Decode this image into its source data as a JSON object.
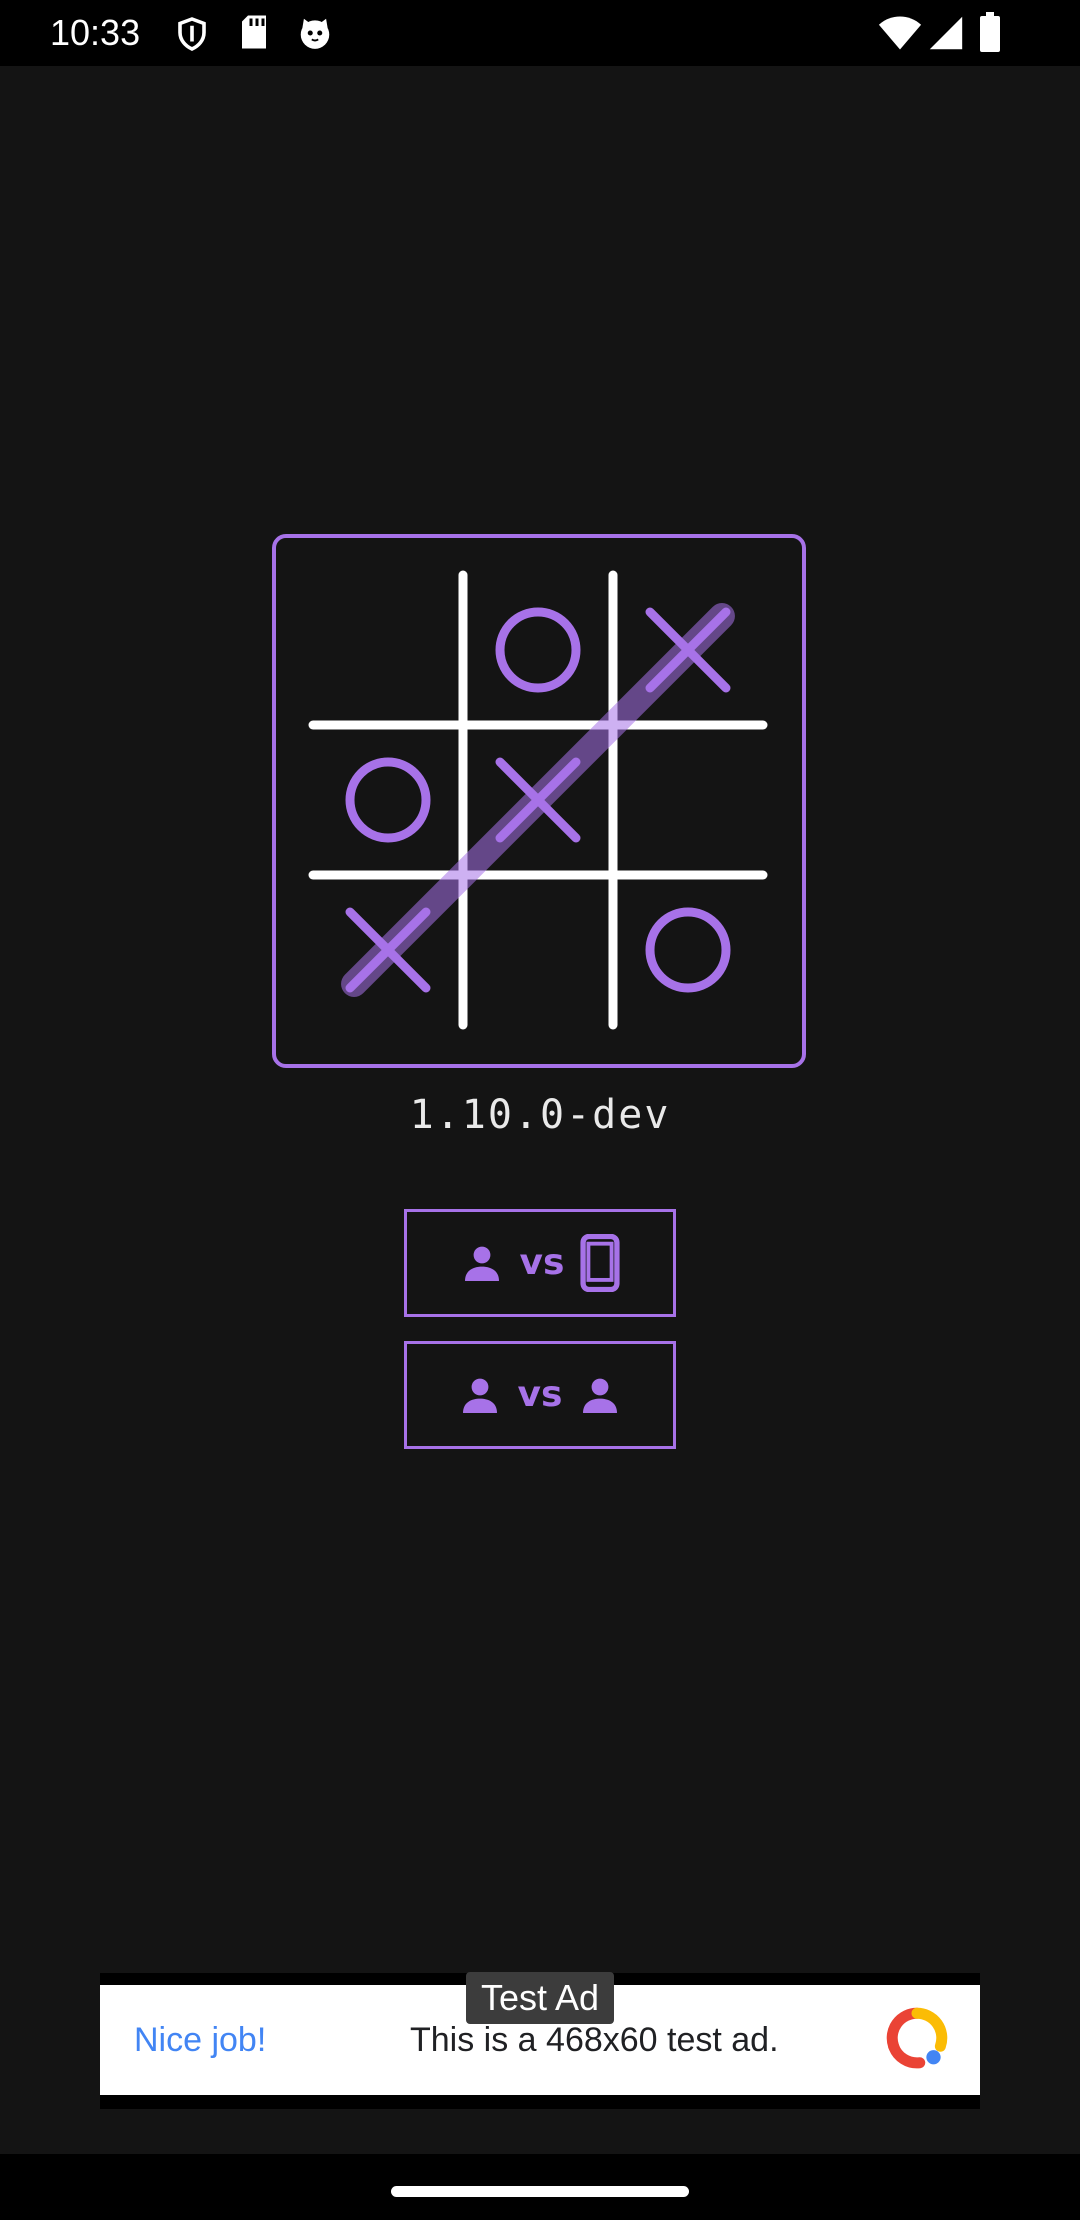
{
  "status_bar": {
    "time": "10:33",
    "left_icons": [
      "shield-icon",
      "sd-card-icon",
      "cat-face-icon"
    ],
    "right_icons": [
      "wifi-icon",
      "cell-signal-icon",
      "battery-icon"
    ]
  },
  "logo": {
    "board": [
      "",
      "O",
      "X",
      "O",
      "X",
      "",
      "X",
      "",
      "O"
    ],
    "winning_line": [
      6,
      4,
      2
    ],
    "accent_color": "#a772e8",
    "line_color": "#ffffff"
  },
  "version": "1.10.0-dev",
  "mode_buttons": [
    {
      "name": "player-vs-phone",
      "vs_label": "vs",
      "left_icon": "person-icon",
      "right_icon": "phone-icon"
    },
    {
      "name": "player-vs-player",
      "vs_label": "vs",
      "left_icon": "person-icon",
      "right_icon": "person-icon"
    }
  ],
  "ad": {
    "tag": "Test Ad",
    "headline": "Nice job!",
    "body": "This is a 468x60 test ad.",
    "logo_icon": "ad-network-logo-icon",
    "headline_color": "#4285f4"
  },
  "colors": {
    "background": "#141414",
    "accent": "#a772e8"
  }
}
